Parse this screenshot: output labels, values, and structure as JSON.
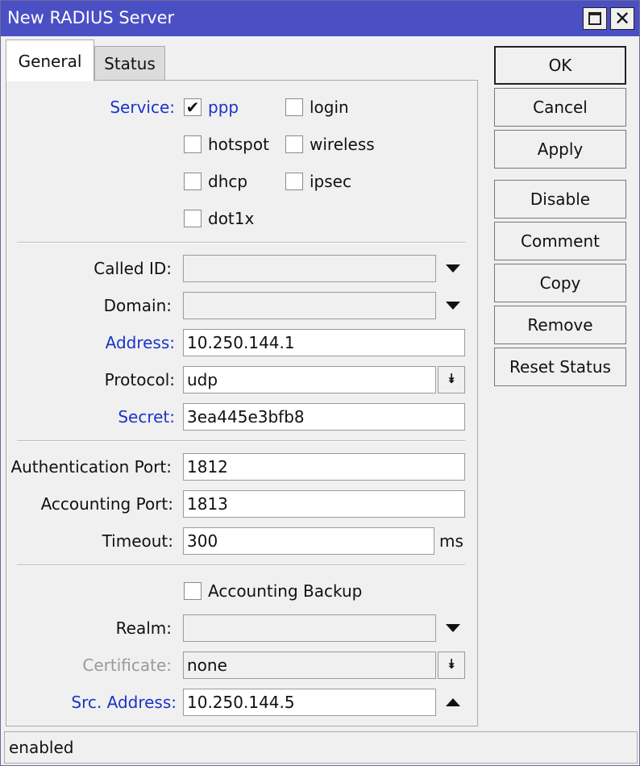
{
  "window": {
    "title": "New RADIUS Server"
  },
  "tabs": [
    {
      "label": "General"
    },
    {
      "label": "Status"
    }
  ],
  "service": {
    "label": "Service:",
    "options": [
      {
        "label": "ppp",
        "checked": true
      },
      {
        "label": "login",
        "checked": false
      },
      {
        "label": "hotspot",
        "checked": false
      },
      {
        "label": "wireless",
        "checked": false
      },
      {
        "label": "dhcp",
        "checked": false
      },
      {
        "label": "ipsec",
        "checked": false
      },
      {
        "label": "dot1x",
        "checked": false
      }
    ]
  },
  "fields": {
    "called_id": {
      "label": "Called ID:",
      "value": ""
    },
    "domain": {
      "label": "Domain:",
      "value": ""
    },
    "address": {
      "label": "Address:",
      "value": "10.250.144.1"
    },
    "protocol": {
      "label": "Protocol:",
      "value": "udp"
    },
    "secret": {
      "label": "Secret:",
      "value": "3ea445e3bfb8"
    },
    "auth_port": {
      "label": "Authentication Port:",
      "value": "1812"
    },
    "acct_port": {
      "label": "Accounting Port:",
      "value": "1813"
    },
    "timeout": {
      "label": "Timeout:",
      "value": "300",
      "unit": "ms"
    },
    "accounting_backup": {
      "label": "Accounting Backup",
      "checked": false
    },
    "realm": {
      "label": "Realm:",
      "value": ""
    },
    "certificate": {
      "label": "Certificate:",
      "value": "none"
    },
    "src_address": {
      "label": "Src. Address:",
      "value": "10.250.144.5"
    }
  },
  "buttons": {
    "ok": "OK",
    "cancel": "Cancel",
    "apply": "Apply",
    "disable": "Disable",
    "comment": "Comment",
    "copy": "Copy",
    "remove": "Remove",
    "reset_status": "Reset Status"
  },
  "status": {
    "text": "enabled"
  },
  "colors": {
    "titlebar": "#4a4fc4",
    "blue_label": "#1a34c8",
    "disabled_label": "#9a9a9a"
  }
}
